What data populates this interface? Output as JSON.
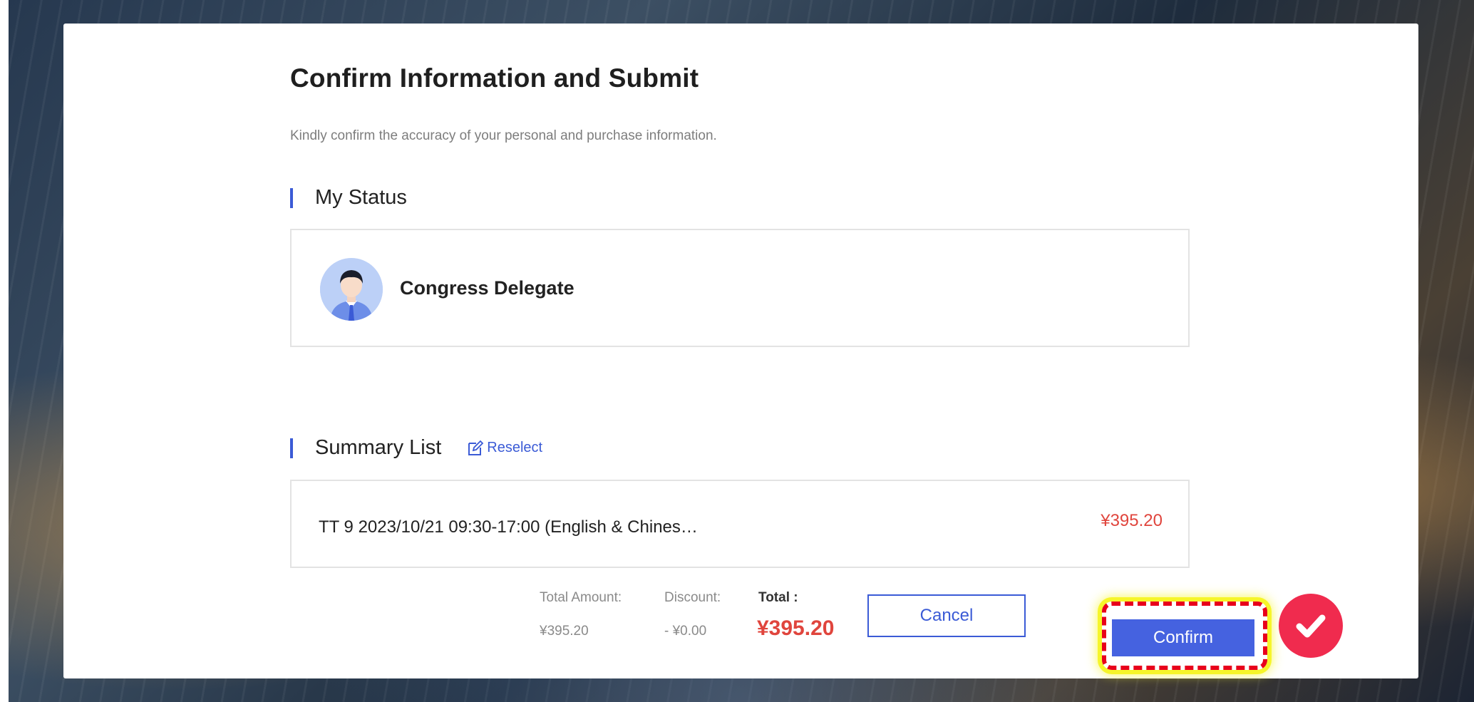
{
  "modal": {
    "title": "Confirm Information and Submit",
    "subtitle": "Kindly confirm the accuracy of your personal and purchase information."
  },
  "status": {
    "heading": "My Status",
    "label": "Congress Delegate",
    "avatar_icon": "person-avatar-icon"
  },
  "summary": {
    "heading": "Summary List",
    "reselect_label": "Reselect",
    "items": [
      {
        "name": "TT 9 2023/10/21 09:30-17:00 (English & Chines…",
        "price": "¥395.20"
      }
    ]
  },
  "totals": {
    "total_amount_label": "Total Amount:",
    "total_amount_value": "¥395.20",
    "discount_label": "Discount:",
    "discount_value": "- ¥0.00",
    "total_label": "Total :",
    "total_value": "¥395.20"
  },
  "actions": {
    "cancel_label": "Cancel",
    "confirm_label": "Confirm"
  },
  "colors": {
    "accent": "#3b5bd6",
    "price": "#e0453d",
    "highlight_border": "#e8001c",
    "highlight_glow": "#f6f52a",
    "check_badge": "#f02b4e"
  }
}
